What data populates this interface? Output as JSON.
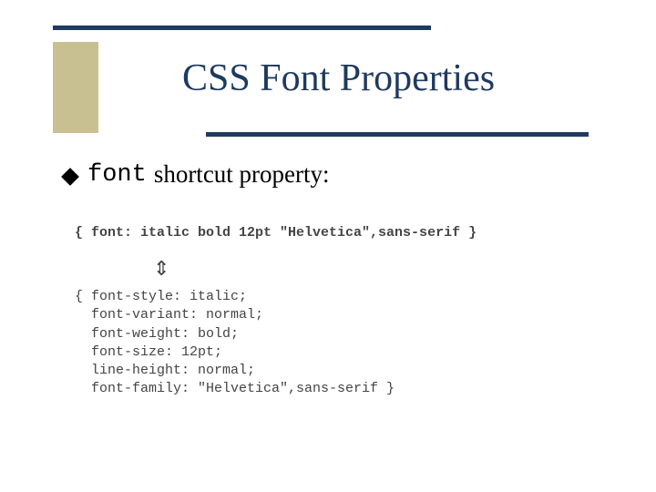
{
  "title": "CSS Font Properties",
  "bullet": {
    "code": "font",
    "text": "shortcut property:"
  },
  "code_example_short": "{ font: italic bold 12pt \"Helvetica\",sans-serif }",
  "equivalence_symbol": "⇕",
  "code_example_long": "{ font-style: italic;\n  font-variant: normal;\n  font-weight: bold;\n  font-size: 12pt;\n  line-height: normal;\n  font-family: \"Helvetica\",sans-serif }",
  "colors": {
    "dark_blue": "#1f3a5f",
    "beige": "#c8c090"
  }
}
